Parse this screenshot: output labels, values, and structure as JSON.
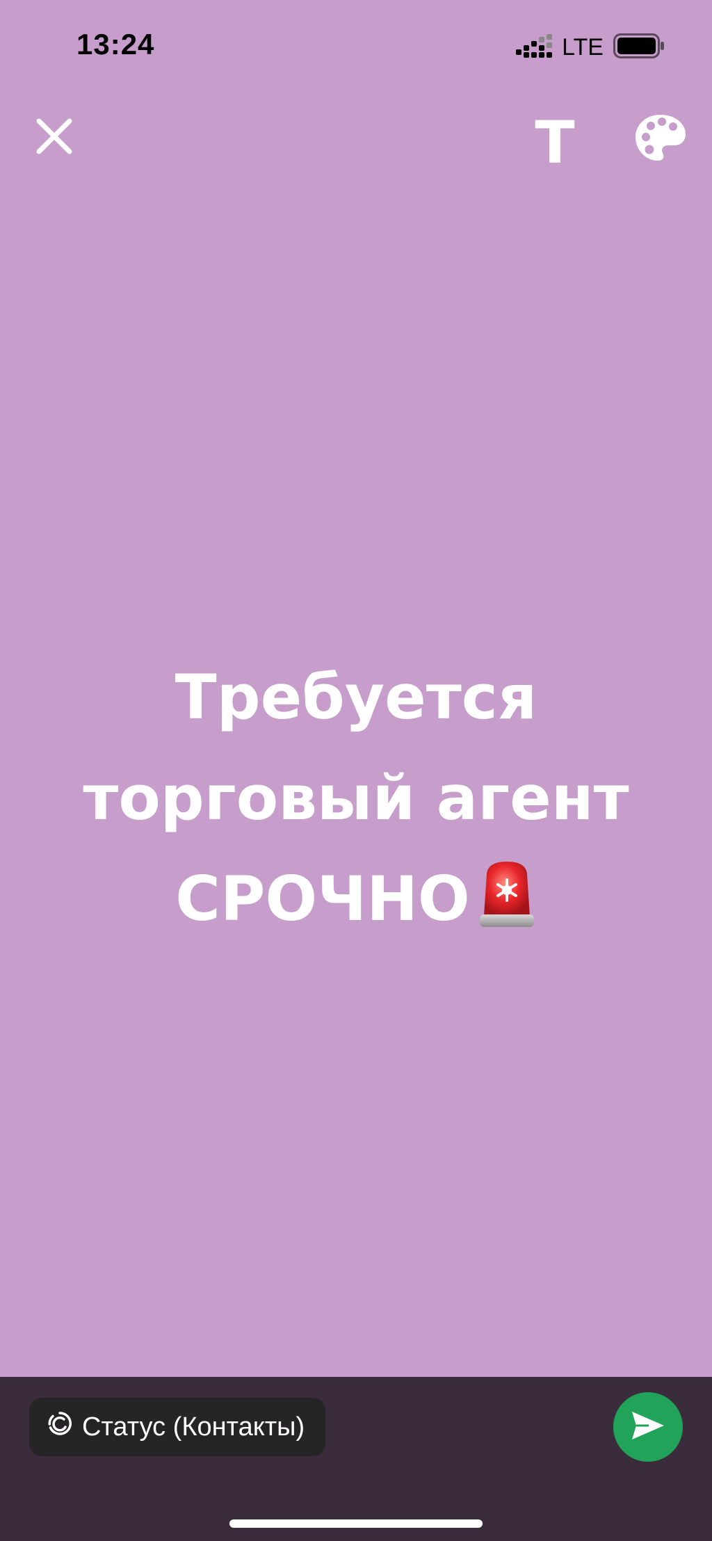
{
  "colors": {
    "background": "#c69dcb",
    "bottom_bar": "#3a2c3b",
    "chip": "#262426",
    "send": "#22a35a",
    "text": "#ffffff"
  },
  "status_bar": {
    "time": "13:24",
    "network": "LTE",
    "icons": [
      "signal-icon",
      "battery-icon"
    ]
  },
  "toolbar": {
    "close_icon": "close-icon",
    "text_label": "T",
    "palette_icon": "palette-icon"
  },
  "status": {
    "lines": [
      "Требуется",
      "торговый агент",
      "СРОЧНО"
    ],
    "emoji": "siren-icon"
  },
  "bottom": {
    "audience_label": "Статус (Контакты)",
    "audience_icon": "status-ring-icon",
    "send_icon": "send-icon"
  }
}
